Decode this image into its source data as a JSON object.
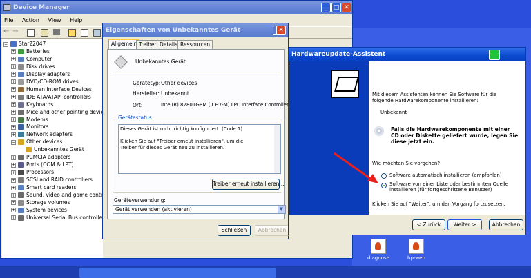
{
  "device_manager": {
    "title": "Device Manager",
    "menu": [
      "File",
      "Action",
      "View",
      "Help"
    ],
    "tree": [
      {
        "label": "Star22047",
        "exp": "⊟",
        "depth": 0,
        "color": "#4a6fc7"
      },
      {
        "label": "Batteries",
        "exp": "⊞",
        "depth": 1,
        "color": "#3c9a3c"
      },
      {
        "label": "Computer",
        "exp": "⊞",
        "depth": 1,
        "color": "#5a7fbf"
      },
      {
        "label": "Disk drives",
        "exp": "⊞",
        "depth": 1,
        "color": "#8a8a8a"
      },
      {
        "label": "Display adapters",
        "exp": "⊞",
        "depth": 1,
        "color": "#5a7fbf"
      },
      {
        "label": "DVD/CD-ROM drives",
        "exp": "⊞",
        "depth": 1,
        "color": "#9a9a9a"
      },
      {
        "label": "Human Interface Devices",
        "exp": "⊞",
        "depth": 1,
        "color": "#8f6a3a"
      },
      {
        "label": "IDE ATA/ATAPI controllers",
        "exp": "⊞",
        "depth": 1,
        "color": "#7a7a7a"
      },
      {
        "label": "Keyboards",
        "exp": "⊞",
        "depth": 1,
        "color": "#6f6f8f"
      },
      {
        "label": "Mice and other pointing devices",
        "exp": "⊞",
        "depth": 1,
        "color": "#6f6f6f"
      },
      {
        "label": "Modems",
        "exp": "⊞",
        "depth": 1,
        "color": "#4a7a4a"
      },
      {
        "label": "Monitors",
        "exp": "⊞",
        "depth": 1,
        "color": "#3a5fa0"
      },
      {
        "label": "Network adapters",
        "exp": "⊞",
        "depth": 1,
        "color": "#3c7a9a"
      },
      {
        "label": "Other devices",
        "exp": "⊟",
        "depth": 1,
        "color": "#d6a520"
      },
      {
        "label": "Unbekanntes Gerät",
        "exp": "",
        "depth": 2,
        "color": "#d6a520"
      },
      {
        "label": "PCMCIA adapters",
        "exp": "⊞",
        "depth": 1,
        "color": "#6a6a6a"
      },
      {
        "label": "Ports (COM & LPT)",
        "exp": "⊞",
        "depth": 1,
        "color": "#5a5a8a"
      },
      {
        "label": "Processors",
        "exp": "⊞",
        "depth": 1,
        "color": "#4a4a4a"
      },
      {
        "label": "SCSI and RAID controllers",
        "exp": "⊞",
        "depth": 1,
        "color": "#7a7a7a"
      },
      {
        "label": "Smart card readers",
        "exp": "⊞",
        "depth": 1,
        "color": "#5a7fbf"
      },
      {
        "label": "Sound, video and game controll",
        "exp": "⊞",
        "depth": 1,
        "color": "#6a6a6a"
      },
      {
        "label": "Storage volumes",
        "exp": "⊞",
        "depth": 1,
        "color": "#8a8a8a"
      },
      {
        "label": "System devices",
        "exp": "⊞",
        "depth": 1,
        "color": "#5a7fbf"
      },
      {
        "label": "Universal Serial Bus controllers",
        "exp": "⊞",
        "depth": 1,
        "color": "#6a6a6a"
      }
    ]
  },
  "properties": {
    "title": "Eigenschaften von Unbekanntes Gerät",
    "tabs": [
      "Allgemein",
      "Treiber",
      "Details",
      "Ressourcen"
    ],
    "device_name": "Unbekanntes Gerät",
    "fields": [
      {
        "label": "Gerätetyp:",
        "value": "Other devices"
      },
      {
        "label": "Hersteller:",
        "value": "Unbekannt"
      },
      {
        "label": "Ort:",
        "value": "Intel(R) 82801GBM (ICH7-M) LPC Interface Controller -"
      }
    ],
    "status_group": "Gerätestatus",
    "status_line1": "Dieses Gerät ist nicht richtig konfiguriert. (Code 1)",
    "status_line2": "Klicken Sie auf \"Treiber erneut installieren\", um die Treiber für dieses Gerät neu zu installieren.",
    "reinstall_button": "Treiber erneut installieren...",
    "usage_label": "Geräteverwendung:",
    "usage_value": "Gerät verwenden (aktivieren)",
    "close_button": "Schließen",
    "cancel_button": "Abbrechen"
  },
  "wizard": {
    "title": "Hardwareupdate-Assistent",
    "intro": "Mit diesem Assistenten können Sie Software für die folgende Hardwarekomponente installieren:",
    "device": "Unbekannt",
    "cd_hint": "Falls die Hardwarekomponente mit einer CD oder Diskette geliefert wurde, legen Sie diese jetzt ein.",
    "question": "Wie möchten Sie vorgehen?",
    "option_auto": "Software automatisch installieren (empfohlen)",
    "option_list": "Software von einer Liste oder bestimmten Quelle installieren (für fortgeschrittene Benutzer)",
    "continue_text": "Klicken Sie auf \"Weiter\", um den Vorgang fortzusetzen.",
    "back_button": "< Zurück",
    "next_button": "Weiter >",
    "cancel_button": "Abbrechen"
  },
  "desktop_icons": [
    "diagnose",
    "hp-web"
  ]
}
